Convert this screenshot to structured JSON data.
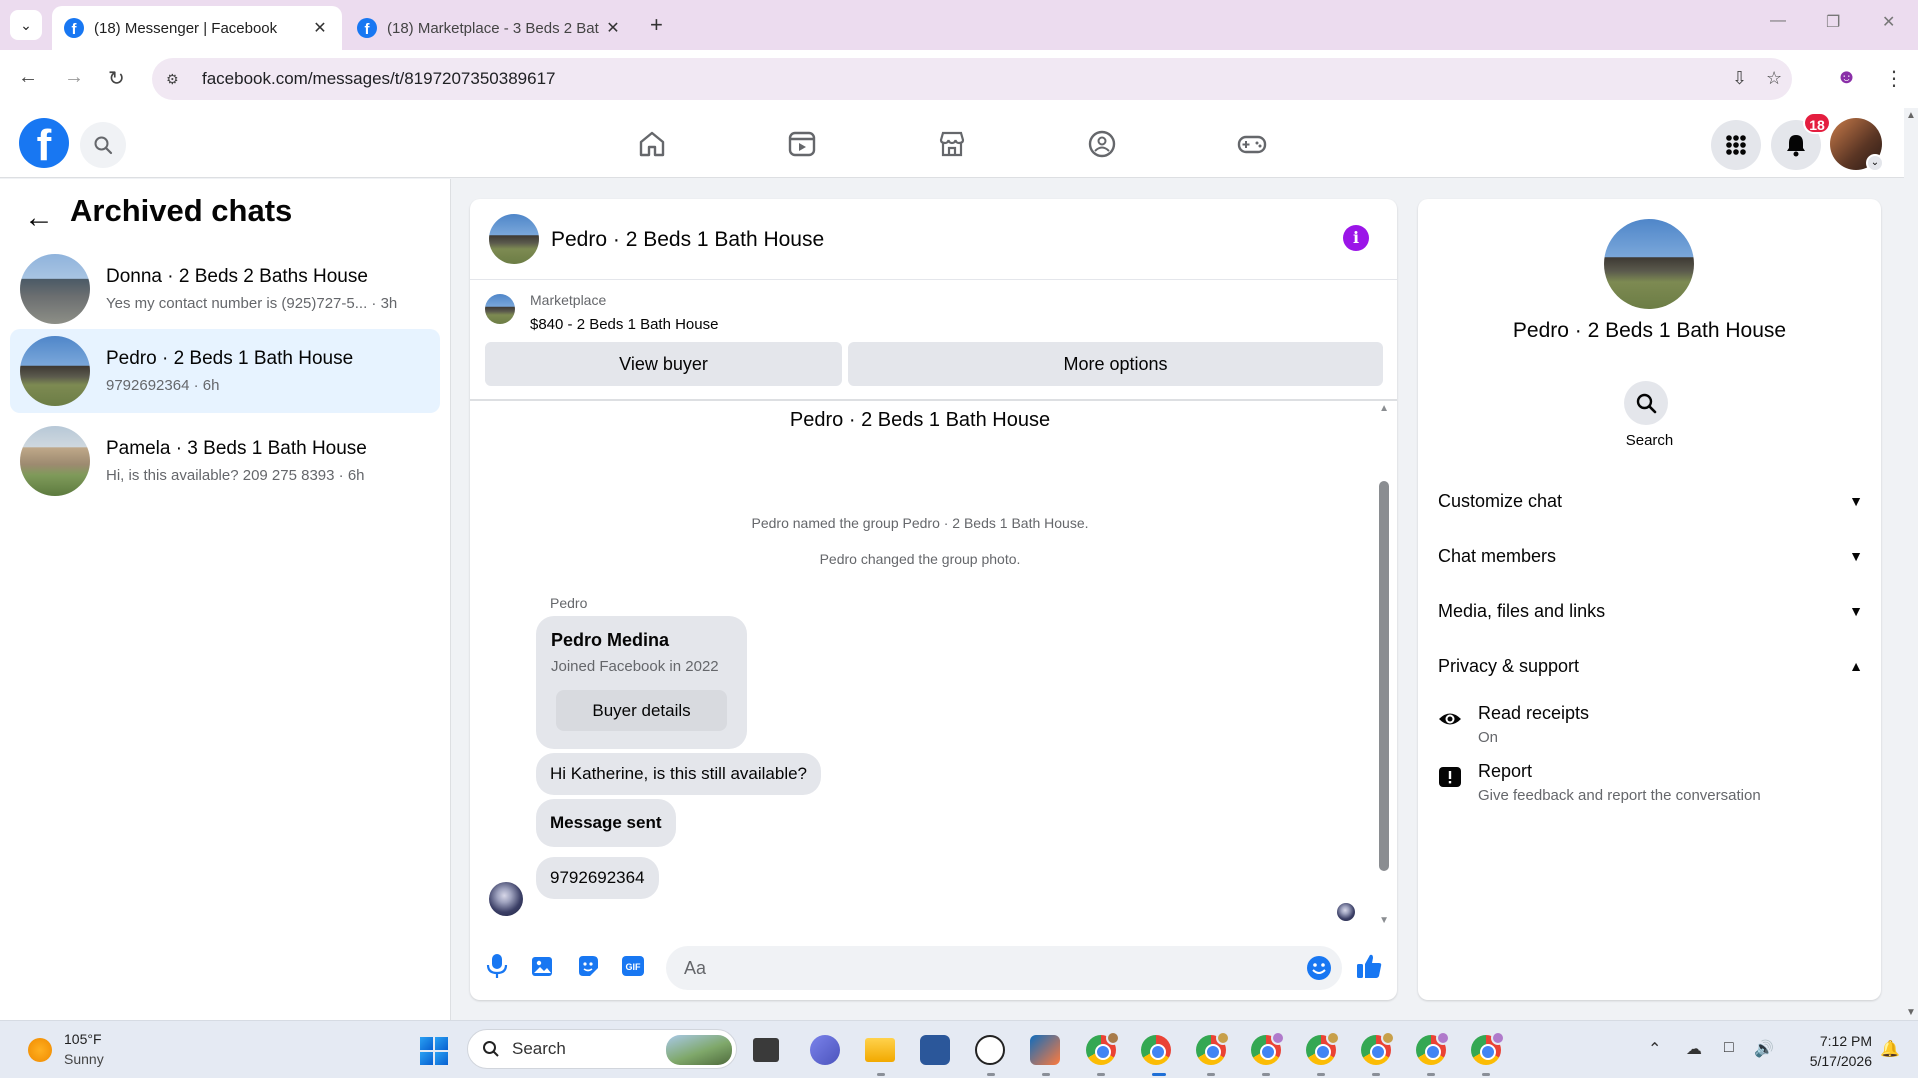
{
  "browser": {
    "tabs": [
      {
        "title": "(18) Messenger | Facebook",
        "active": true
      },
      {
        "title": "(18) Marketplace - 3 Beds 2 Bat",
        "active": false
      }
    ],
    "url": "facebook.com/messages/t/8197207350389617"
  },
  "header": {
    "logo": "f",
    "notification_count": "18",
    "icons": [
      "home-icon",
      "reels-icon",
      "marketplace-icon",
      "groups-icon",
      "gaming-icon",
      "menu-grid-icon",
      "bell-icon"
    ]
  },
  "left_panel": {
    "title": "Archived chats",
    "chats": [
      {
        "name": "Donna · 2 Beds 2 Baths House",
        "preview": "Yes my contact number is (925)727-5...",
        "time": " · 3h",
        "selected": false
      },
      {
        "name": "Pedro · 2 Beds 1 Bath House",
        "preview": "9792692364",
        "time": " · 6h",
        "selected": true
      },
      {
        "name": "Pamela · 3 Beds 1 Bath House",
        "preview": "Hi, is this available? 209 275 8393",
        "time": " · 6h",
        "selected": false
      }
    ]
  },
  "conversation": {
    "title": "Pedro · 2 Beds 1 Bath House",
    "marketplace_label": "Marketplace",
    "listing": "$840 - 2 Beds 1 Bath House",
    "view_buyer": "View buyer",
    "more_options": "More options",
    "thread_title": "Pedro · 2 Beds 1 Bath House",
    "system_messages": [
      "Pedro named the group Pedro · 2 Beds 1 Bath House.",
      "Pedro changed the group photo."
    ],
    "sender": "Pedro",
    "buyer_card": {
      "name": "Pedro Medina",
      "joined": "Joined Facebook in 2022",
      "button": "Buyer details"
    },
    "messages": [
      "Hi Katherine, is this still available?",
      "Message sent",
      "9792692364"
    ],
    "composer_placeholder": "Aa"
  },
  "right_panel": {
    "name": "Pedro · 2 Beds 1 Bath House",
    "search_label": "Search",
    "sections": [
      {
        "label": "Customize chat",
        "expanded": false
      },
      {
        "label": "Chat members",
        "expanded": false
      },
      {
        "label": "Media, files and links",
        "expanded": false
      },
      {
        "label": "Privacy & support",
        "expanded": true
      }
    ],
    "privacy_items": [
      {
        "title": "Read receipts",
        "sub": "On"
      },
      {
        "title": "Report",
        "sub": "Give feedback and report the conversation"
      }
    ]
  },
  "taskbar": {
    "temp": "105°F",
    "condition": "Sunny",
    "search_label": "Search",
    "time": "7:12 PM",
    "date": "5/17/2026"
  },
  "colors": {
    "fb_blue": "#1877f2",
    "accent_purple": "#9b15e8",
    "selected_bg": "#e7f3ff",
    "badge_red": "#e41e3f"
  }
}
